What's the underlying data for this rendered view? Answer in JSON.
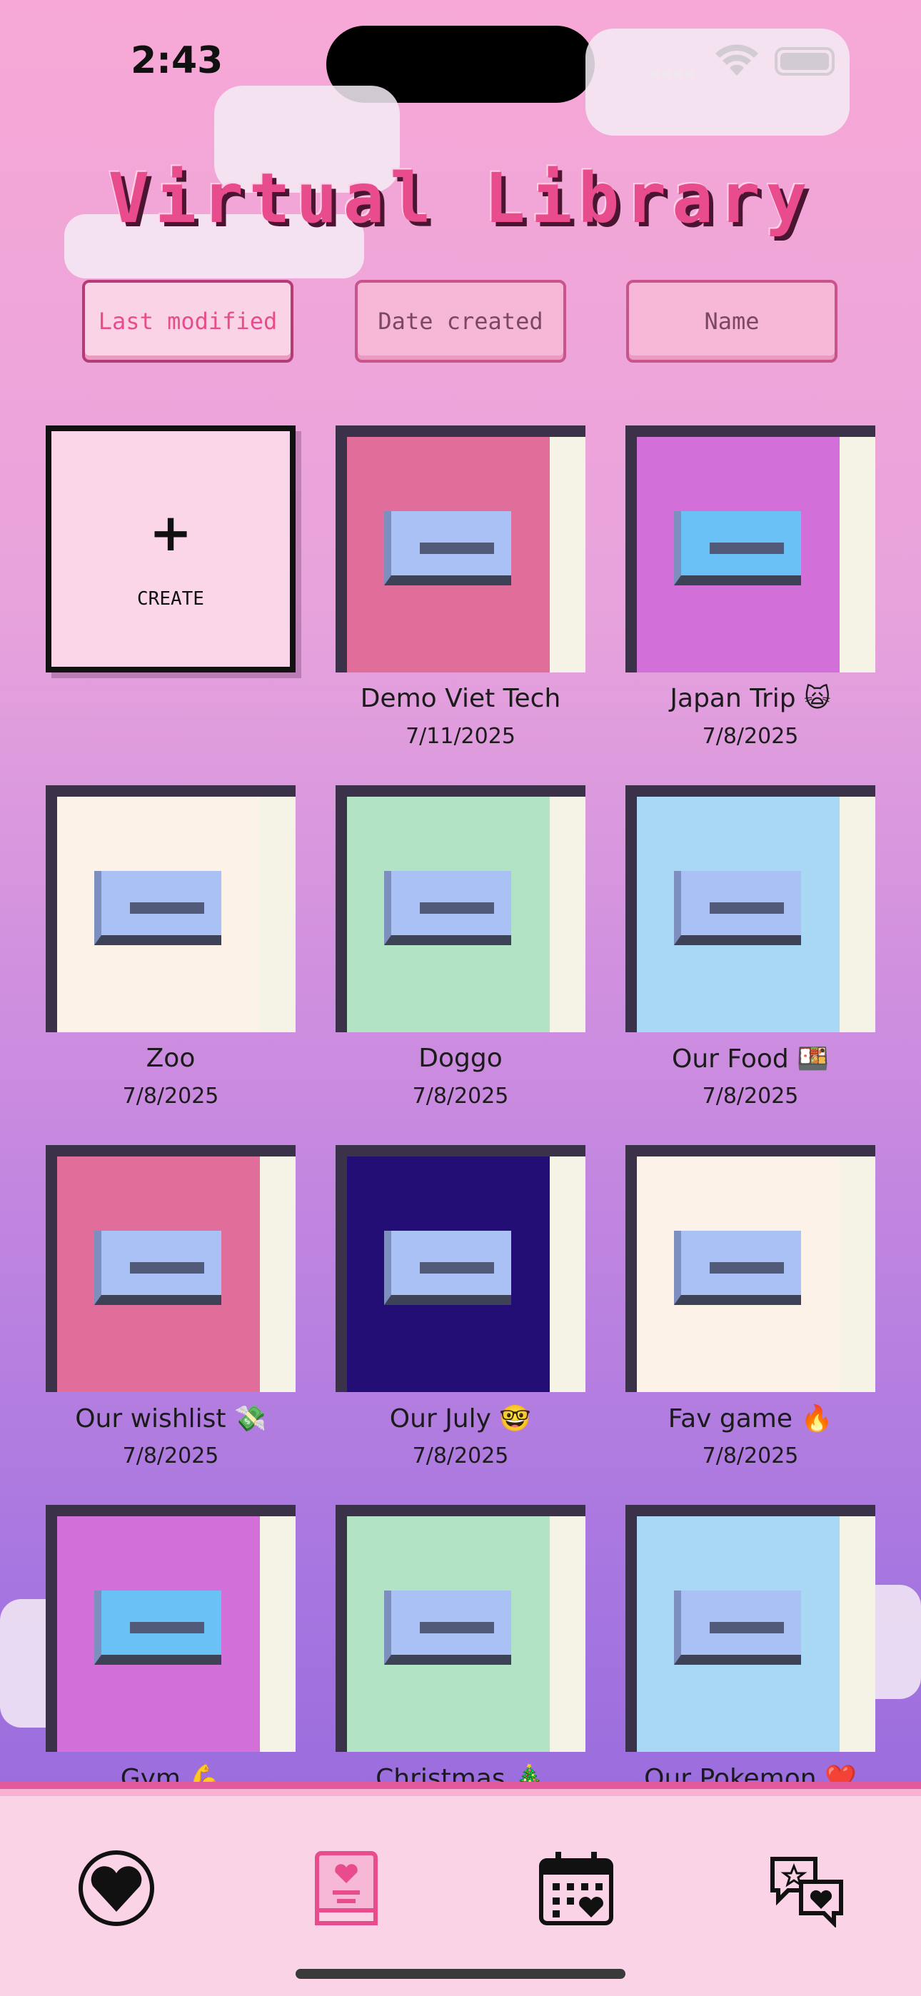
{
  "status_bar": {
    "time": "2:43"
  },
  "header": {
    "title": "Virtual Library"
  },
  "sort": {
    "options": [
      {
        "label": "Last modified",
        "active": true
      },
      {
        "label": "Date created",
        "active": false
      },
      {
        "label": "Name",
        "active": false
      }
    ]
  },
  "create_card": {
    "plus": "+",
    "label": "CREATE"
  },
  "books": [
    {
      "name": "Demo Viet Tech",
      "date": "7/11/2025",
      "cover": "#e06d9a",
      "label": "#a9c1f5"
    },
    {
      "name": "Japan Trip 🙀",
      "date": "7/8/2025",
      "cover": "#d36fd8",
      "label": "#6ac1f5"
    },
    {
      "name": "Zoo",
      "date": "7/8/2025",
      "cover": "#fdf2e8",
      "label": "#a9c1f5"
    },
    {
      "name": "Doggo",
      "date": "7/8/2025",
      "cover": "#b3e3c5",
      "label": "#a9c1f5"
    },
    {
      "name": "Our Food 🍱",
      "date": "7/8/2025",
      "cover": "#a8d8f3",
      "label": "#a9c1f5"
    },
    {
      "name": "Our wishlist 💸",
      "date": "7/8/2025",
      "cover": "#e06d9a",
      "label": "#a9c1f5"
    },
    {
      "name": "Our July 🤓",
      "date": "7/8/2025",
      "cover": "#230e76",
      "label": "#a9c1f5"
    },
    {
      "name": "Fav game 🔥",
      "date": "7/8/2025",
      "cover": "#fdf2e8",
      "label": "#a9c1f5"
    },
    {
      "name": "Gym 💪",
      "date": "",
      "cover": "#d36fd8",
      "label": "#6ac1f5"
    },
    {
      "name": "Christmas 🎄",
      "date": "",
      "cover": "#b3e3c5",
      "label": "#a9c1f5"
    },
    {
      "name": "Our Pokemon ❤️",
      "date": "",
      "cover": "#a8d8f3",
      "label": "#a9c1f5"
    }
  ],
  "tabbar": {
    "items": [
      {
        "icon": "heart-icon",
        "active": false
      },
      {
        "icon": "book-icon",
        "active": true
      },
      {
        "icon": "calendar-icon",
        "active": false
      },
      {
        "icon": "chat-icon",
        "active": false
      }
    ]
  },
  "colors": {
    "accent": "#e94c8c",
    "title_shadow": "#4a1530"
  }
}
